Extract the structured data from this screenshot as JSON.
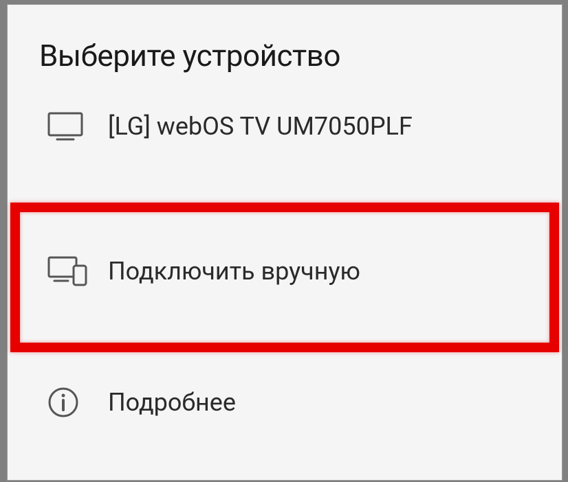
{
  "header": {
    "title": "Выберите устройство"
  },
  "items": [
    {
      "label": "[LG] webOS TV UM7050PLF",
      "icon": "tv-icon"
    },
    {
      "label": "Подключить вручную",
      "icon": "devices-icon"
    },
    {
      "label": "Подробнее",
      "icon": "info-icon"
    }
  ]
}
